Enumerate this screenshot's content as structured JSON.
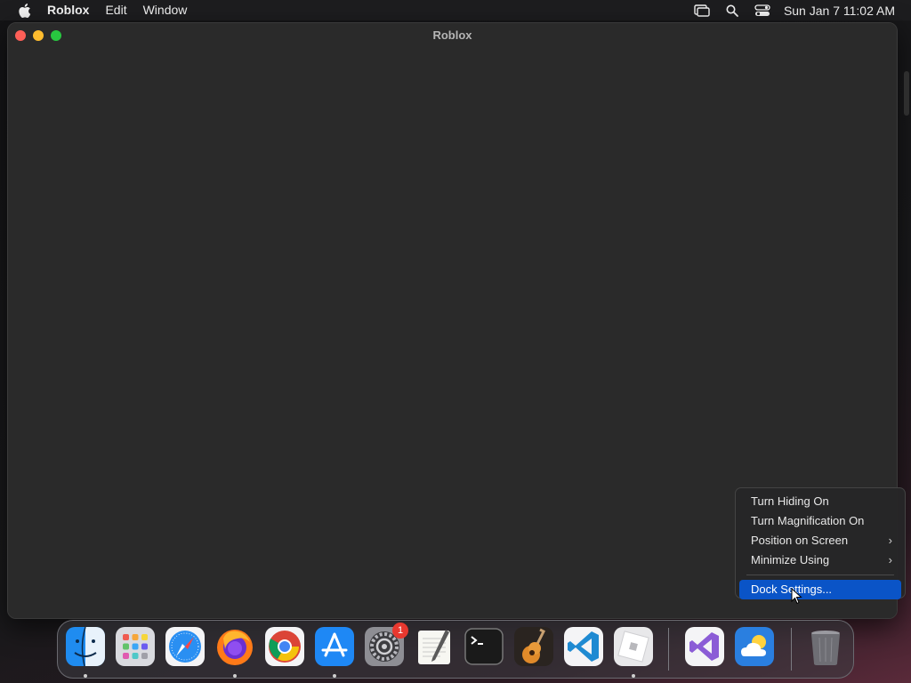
{
  "menubar": {
    "app_name": "Roblox",
    "menus": [
      "Edit",
      "Window"
    ],
    "clock": "Sun Jan 7  11:02 AM"
  },
  "window": {
    "title": "Roblox"
  },
  "context_menu": {
    "items": [
      {
        "label": "Turn Hiding On"
      },
      {
        "label": "Turn Magnification On"
      },
      {
        "label": "Position on Screen"
      },
      {
        "label": "Minimize Using"
      },
      {
        "label": "Dock Settings..."
      }
    ]
  },
  "dock": {
    "apps": [
      {
        "name": "Finder",
        "icon": "finder-icon",
        "running": true
      },
      {
        "name": "Launchpad",
        "icon": "launchpad-icon",
        "running": false
      },
      {
        "name": "Safari",
        "icon": "safari-icon",
        "running": false
      },
      {
        "name": "Firefox",
        "icon": "firefox-icon",
        "running": true
      },
      {
        "name": "Google Chrome",
        "icon": "chrome-icon",
        "running": false
      },
      {
        "name": "App Store",
        "icon": "app-store-icon",
        "running": true
      },
      {
        "name": "System Settings",
        "icon": "system-settings-icon",
        "running": false,
        "badge": "1"
      },
      {
        "name": "TextEdit",
        "icon": "textedit-icon",
        "running": false
      },
      {
        "name": "Terminal",
        "icon": "terminal-icon",
        "running": false
      },
      {
        "name": "GarageBand",
        "icon": "garageband-icon",
        "running": false
      },
      {
        "name": "Visual Studio Code",
        "icon": "vscode-icon",
        "running": false
      },
      {
        "name": "Roblox",
        "icon": "roblox-icon",
        "running": true
      },
      {
        "name": "Visual Studio",
        "icon": "visual-studio-icon",
        "running": false
      },
      {
        "name": "Weather",
        "icon": "weather-icon",
        "running": false
      },
      {
        "name": "Trash",
        "icon": "trash-icon",
        "running": false
      }
    ]
  },
  "colors": {
    "menu_highlight": "#0a54c7",
    "badge": "#e8382f"
  }
}
